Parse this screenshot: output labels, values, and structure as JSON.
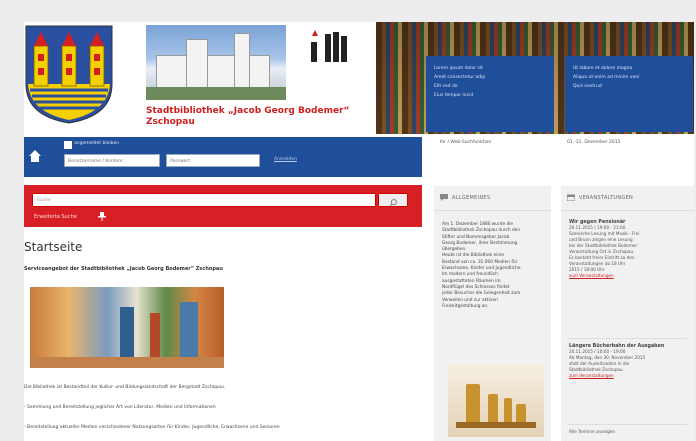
{
  "header": {
    "site_title_line1": "Stadtbibliothek „Jacob Georg Bodemer“",
    "site_title_line2": "Zschopau",
    "box1_items": [
      "Lorem ipsum dolor sit",
      "Amet consectetur adip",
      "Elit sed do",
      "Eius tempor incid"
    ],
    "box2_items": [
      "Ut labore et dolore magna",
      "Aliqua ut enim ad minim veni",
      "Quis nostrud"
    ]
  },
  "nav": {
    "checkbox_label": "angemeldet bleiben",
    "username_placeholder": "Benutzername / Kontonr.",
    "password_placeholder": "Passwort",
    "login_link": "Anmelden",
    "col2_top": "Ihr / Web-Suchfunktion",
    "col3_top": "01.-31. Dezember 2015"
  },
  "search": {
    "placeholder": "Suche",
    "extended_label": "Erweiterte Suche"
  },
  "main": {
    "title": "Startseite",
    "subtitle": "Serviceangebot der Stadtbibliothek „Jacob Georg Bodemer“ Zschopau",
    "paragraphs": [
      "Die Bibliothek ist Bestandteil der Kultur- und Bildungslandschaft der Bergstadt Zschopau.",
      "- Sammlung und Bereitstellung jeglicher Art von Literatur, Medien und Informationen",
      "- Bereitstellung aktueller Medien verschiedener Nutzungsarten für Kinder, Jugendliche, Erwachsene und Senioren"
    ]
  },
  "col2": {
    "heading": "ALLGEMEINES",
    "text_lines": [
      "Am 1. Dezember 1880 wurde die",
      "Stadtbibliothek Zschopau durch den",
      "Stifter und Namensgeber Jacob",
      "Georg Bodemer, ihrer Bestimmung",
      "übergeben.",
      "Heute ist die Bibliothek einer",
      "Bestand von ca. 31.000 Medien für",
      "Erwachsene, Kinder und Jugendliche.",
      "Im modern und freundlich",
      "ausgestatteten Räumen im",
      "Nordflügel des Schlosses findet",
      "jeder Besucher die Gelegenheit zum",
      "Verweilen und zur aktiven",
      "Freizeitgestaltung an."
    ]
  },
  "col3": {
    "heading": "VERANSTALTUNGEN",
    "events": [
      {
        "title": "Wir gegen Pensionär",
        "date": "20.11.2015 | 19:00 - 21:00",
        "lines": [
          "Szenische Lesung mit Musik - Frei",
          "und Brunn zeigen eine Lesung",
          "bei der Stadtbibliothek Bodemer",
          "Veranstaltung Ort in Zschopau",
          "Es besteht freier Eintritt zu den",
          "Veranstaltungen ab 18 Uhr",
          "2015 / 18:00 Uhr"
        ],
        "link": "zum Veranstaltungen"
      },
      {
        "title": "Längere Bücherbahn der Ausgaben",
        "date": "20.11.2015 / 10:00 - 19:00",
        "lines": [
          "Ab Montag, den 30. November 2015",
          "statt der Ausleihzeiten in der",
          "Stadtbibliothek Zschopau"
        ],
        "link": "zum Veranstaltungen"
      }
    ],
    "footer_label": "Alle Termine anzeigen"
  }
}
